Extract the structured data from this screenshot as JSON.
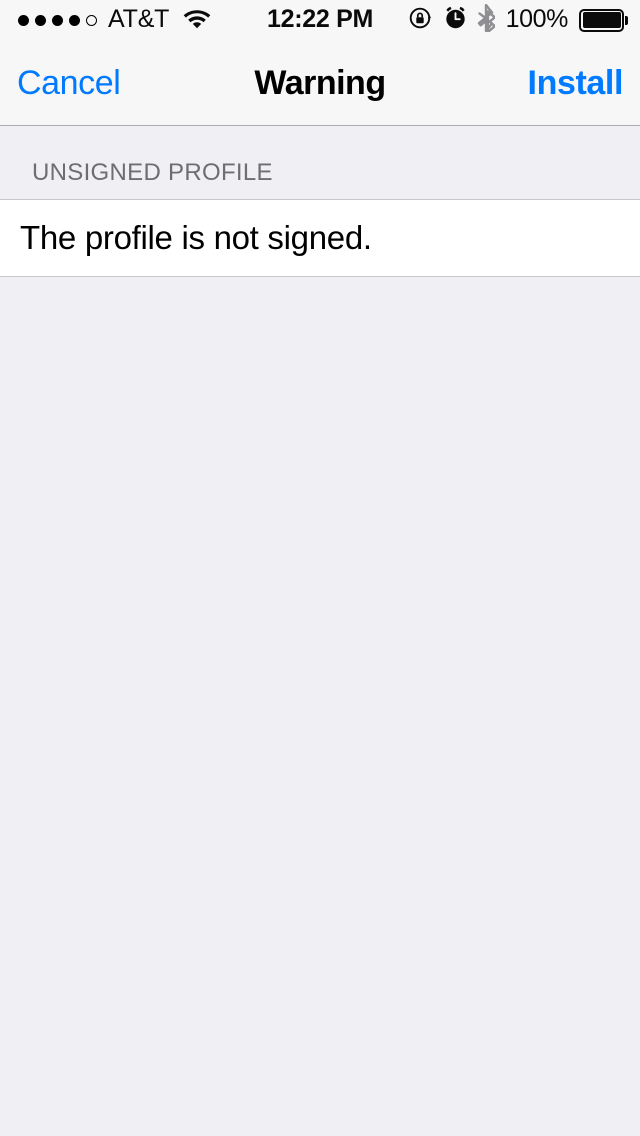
{
  "status_bar": {
    "signal_dots_total": 5,
    "signal_dots_filled": 4,
    "carrier": "AT&T",
    "wifi_icon": "wifi-icon",
    "time": "12:22 PM",
    "rotation_lock_icon": "rotation-lock-icon",
    "alarm_icon": "alarm-clock-icon",
    "bluetooth_icon": "bluetooth-icon",
    "battery_percent": "100%",
    "battery_level": 100
  },
  "nav_bar": {
    "cancel_label": "Cancel",
    "title": "Warning",
    "install_label": "Install"
  },
  "main": {
    "section_header": "UNSIGNED PROFILE",
    "rows": [
      {
        "text": "The profile is not signed."
      }
    ]
  },
  "colors": {
    "accent_blue": "#007AFF",
    "bar_background": "#F7F7F8",
    "group_background": "#EFEFF4",
    "cell_background": "#FFFFFF",
    "separator": "#C8C7CC",
    "header_text": "#6D6D72",
    "bluetooth_gray": "#8E8E93"
  }
}
